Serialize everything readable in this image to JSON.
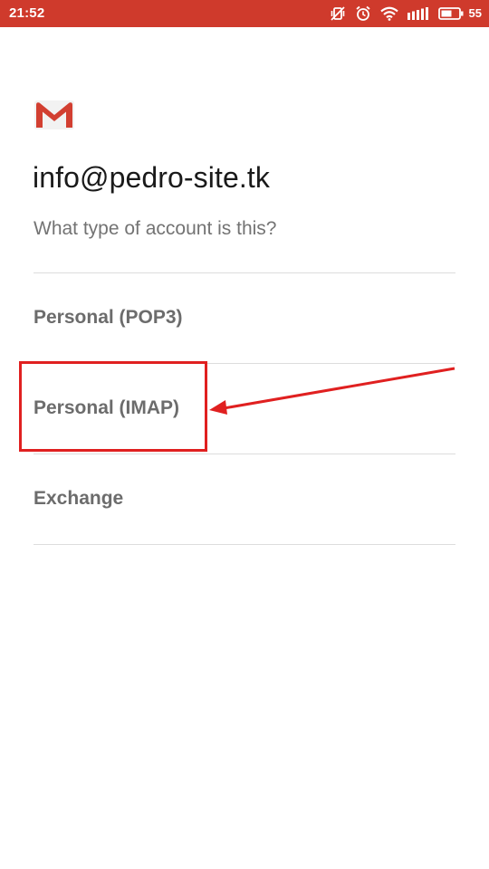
{
  "status_bar": {
    "time": "21:52",
    "battery_level": "55",
    "color": "#cf3a2c",
    "icons": [
      "vibrate-off-icon",
      "alarm-icon",
      "wifi-icon",
      "signal-icon",
      "battery-icon"
    ]
  },
  "app": {
    "logo": "gmail-logo",
    "email": "info@pedro-site.tk",
    "question": "What type of account is this?"
  },
  "options": [
    {
      "label": "Personal (POP3)"
    },
    {
      "label": "Personal (IMAP)"
    },
    {
      "label": "Exchange"
    }
  ],
  "annotation": {
    "highlight_color": "#e02020",
    "highlighted_option": "Personal (IMAP)"
  }
}
